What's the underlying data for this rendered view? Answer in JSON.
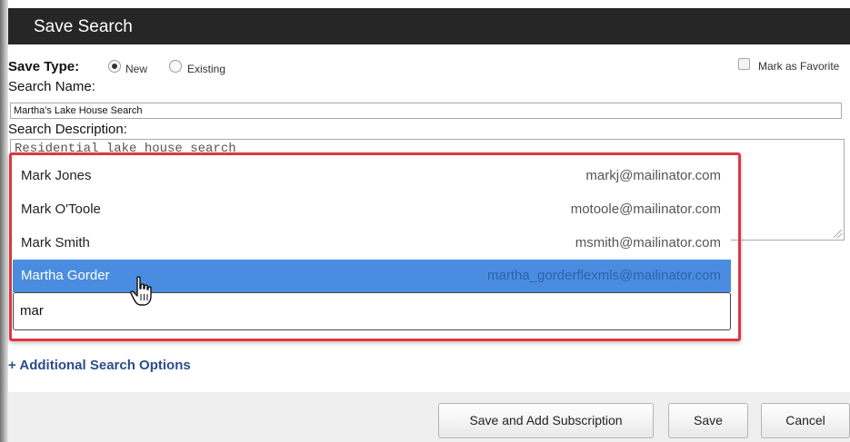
{
  "dialog": {
    "title": "Save Search"
  },
  "save_type": {
    "label": "Save Type:",
    "options": [
      {
        "label": "New",
        "checked": true
      },
      {
        "label": "Existing",
        "checked": false
      }
    ]
  },
  "favorite": {
    "label": "Mark as Favorite",
    "checked": false
  },
  "search_name": {
    "label": "Search Name:",
    "value": "Martha's Lake House Search"
  },
  "search_description": {
    "label": "Search Description:",
    "value": "Residential lake house search"
  },
  "autocomplete": {
    "query": "mar",
    "items": [
      {
        "name": "Mark Jones",
        "email": "markj@mailinator.com",
        "selected": false
      },
      {
        "name": "Mark O'Toole",
        "email": "motoole@mailinator.com",
        "selected": false
      },
      {
        "name": "Mark Smith",
        "email": "msmith@mailinator.com",
        "selected": false
      },
      {
        "name": "Martha Gorder",
        "email": "martha_gorderflexmls@mailinator.com",
        "selected": true
      }
    ]
  },
  "additional_options_link": "+ Additional Search Options",
  "buttons": {
    "save_and_subscribe": "Save and Add Subscription",
    "save": "Save",
    "cancel": "Cancel"
  },
  "colors": {
    "titlebar": "#262626",
    "selection": "#4a8de0",
    "highlight_border": "#e0363e",
    "link": "#2c4c8c"
  },
  "icons": {
    "cursor": "hand-pointer-icon",
    "resize": "resize-grip-icon"
  }
}
